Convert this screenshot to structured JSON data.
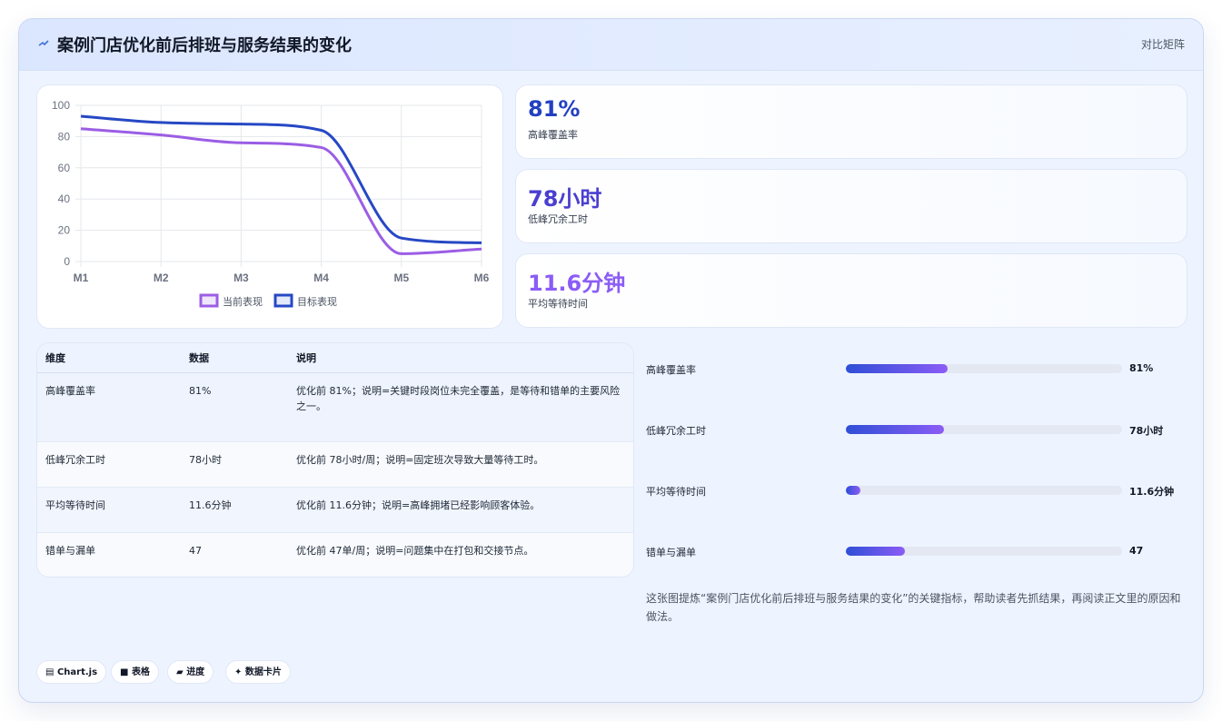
{
  "header": {
    "title": "案例门店优化前后排班与服务结果的变化",
    "tag": "对比矩阵"
  },
  "chart_data": {
    "type": "line",
    "categories": [
      "M1",
      "M2",
      "M3",
      "M4",
      "M5",
      "M6"
    ],
    "ylim": [
      0,
      100
    ],
    "yticks": [
      0,
      20,
      40,
      60,
      80,
      100
    ],
    "grid": true,
    "legend_position": "bottom",
    "series": [
      {
        "name": "当前表现",
        "color": "#9b5de5",
        "values": [
          85,
          81,
          76,
          73,
          5,
          8
        ]
      },
      {
        "name": "目标表现",
        "color": "#2648c4",
        "values": [
          93,
          89,
          88,
          84,
          15,
          12
        ]
      }
    ]
  },
  "kpis": [
    {
      "value": "81%",
      "label": "高峰覆盖率",
      "color": "#2340c0"
    },
    {
      "value": "78小时",
      "label": "低峰冗余工时",
      "color": "#4b3fd1"
    },
    {
      "value": "11.6分钟",
      "label": "平均等待时间",
      "color": "#8b5cf6"
    }
  ],
  "table": {
    "headers": [
      "维度",
      "数据",
      "说明"
    ],
    "rows": [
      {
        "dim": "高峰覆盖率",
        "data": "81%",
        "desc": "优化前 81%；说明=关键时段岗位未完全覆盖，是等待和错单的主要风险之一。"
      },
      {
        "dim": "低峰冗余工时",
        "data": "78小时",
        "desc": "优化前 78小时/周；说明=固定班次导致大量等待工时。"
      },
      {
        "dim": "平均等待时间",
        "data": "11.6分钟",
        "desc": "优化前 11.6分钟；说明=高峰拥堵已经影响顾客体验。"
      },
      {
        "dim": "错单与漏单",
        "data": "47",
        "desc": "优化前 47单/周；说明=问题集中在打包和交接节点。"
      }
    ]
  },
  "progress": [
    {
      "label": "高峰覆盖率",
      "value": "81%",
      "fraction": 0.37
    },
    {
      "label": "低峰冗余工时",
      "value": "78小时",
      "fraction": 0.355
    },
    {
      "label": "平均等待时间",
      "value": "11.6分钟",
      "fraction": 0.053
    },
    {
      "label": "错单与漏单",
      "value": "47",
      "fraction": 0.215
    }
  ],
  "note": "这张图提炼“案例门店优化前后排班与服务结果的变化”的关键指标，帮助读者先抓结果，再阅读正文里的原因和做法。",
  "chips": [
    {
      "icon": "▤",
      "label": "Chart.js"
    },
    {
      "icon": "■",
      "label": "表格"
    },
    {
      "icon": "▰",
      "label": "进度"
    },
    {
      "icon": "✦",
      "label": "数据卡片"
    }
  ]
}
